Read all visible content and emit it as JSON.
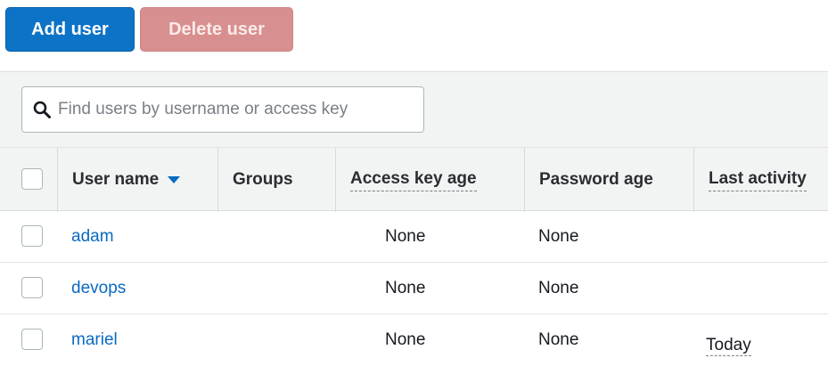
{
  "actions": {
    "add_user_label": "Add user",
    "delete_user_label": "Delete user"
  },
  "search": {
    "placeholder": "Find users by username or access key",
    "value": ""
  },
  "table": {
    "columns": [
      {
        "label": "User name",
        "sorted": "descending"
      },
      {
        "label": "Groups"
      },
      {
        "label": "Access key age"
      },
      {
        "label": "Password age"
      },
      {
        "label": "Last activity"
      }
    ],
    "rows": [
      {
        "user_name": "adam",
        "groups": "",
        "access_key_age": "None",
        "password_age": "None",
        "last_activity": ""
      },
      {
        "user_name": "devops",
        "groups": "",
        "access_key_age": "None",
        "password_age": "None",
        "last_activity": ""
      },
      {
        "user_name": "mariel",
        "groups": "",
        "access_key_age": "None",
        "password_age": "None",
        "last_activity": "Today"
      }
    ]
  },
  "colors": {
    "primary": "#0d73c7",
    "danger_disabled": "#d88f8f",
    "link": "#0a6ac2",
    "header_bg": "#f2f3f3"
  },
  "icons": {
    "search": "search-icon",
    "sort": "caret-down-icon"
  }
}
